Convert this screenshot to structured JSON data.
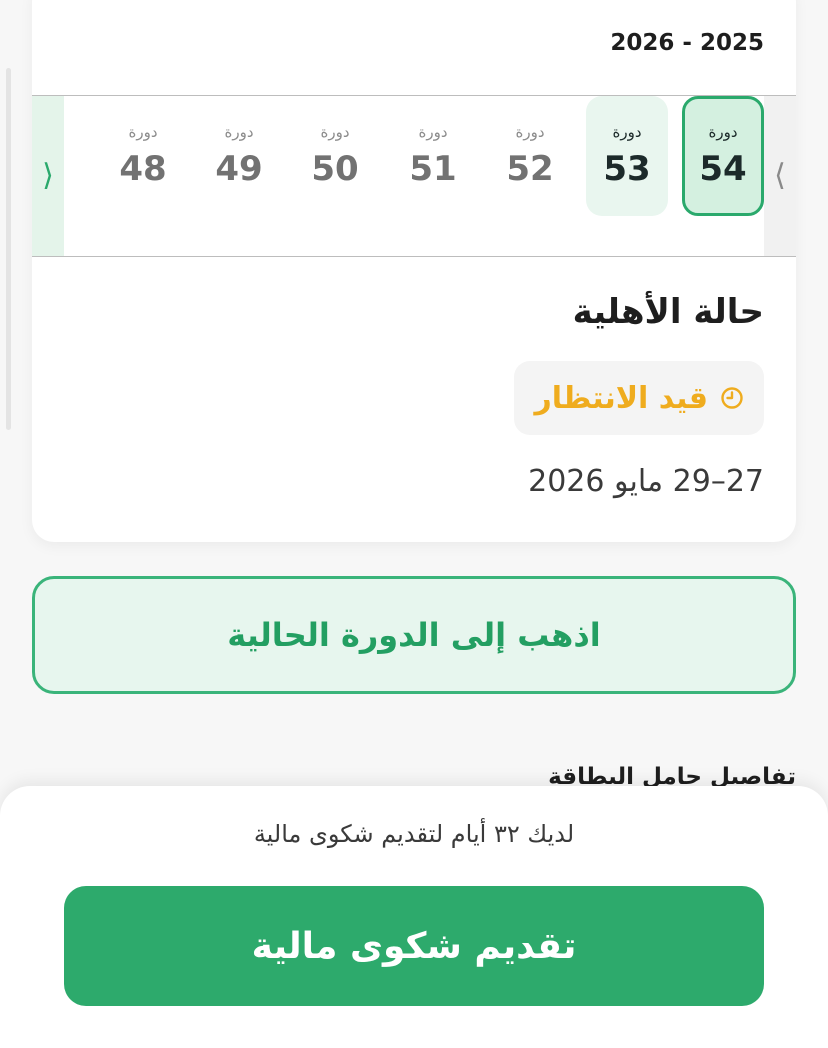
{
  "season": {
    "year_range": "2026 - 2025"
  },
  "cycles": {
    "label": "دورة",
    "items": [
      {
        "number": "54",
        "state": "selected"
      },
      {
        "number": "53",
        "state": "adjacent"
      },
      {
        "number": "52",
        "state": "normal"
      },
      {
        "number": "51",
        "state": "normal"
      },
      {
        "number": "50",
        "state": "normal"
      },
      {
        "number": "49",
        "state": "normal"
      },
      {
        "number": "48",
        "state": "normal"
      }
    ],
    "prev_arrow": "⟨",
    "next_arrow": "⟩"
  },
  "eligibility": {
    "title": "حالة الأهلية",
    "status": "قيد الانتظار",
    "status_icon": "clock-icon",
    "status_color": "#efac1e",
    "dates": "27–29 مايو 2026"
  },
  "actions": {
    "go_current_cycle": "اذهب إلى الدورة الحالية"
  },
  "card_holder": {
    "section_title": "تفاصيل حامل البطاقة"
  },
  "bottom_sheet": {
    "days_left_text": "لديك ٣٢ أيام لتقديم شكوى مالية",
    "submit_label": "تقديم شكوى مالية"
  },
  "colors": {
    "primary_green": "#2daa6c",
    "selected_bg": "#d4f0e0",
    "pending_amber": "#efac1e"
  }
}
